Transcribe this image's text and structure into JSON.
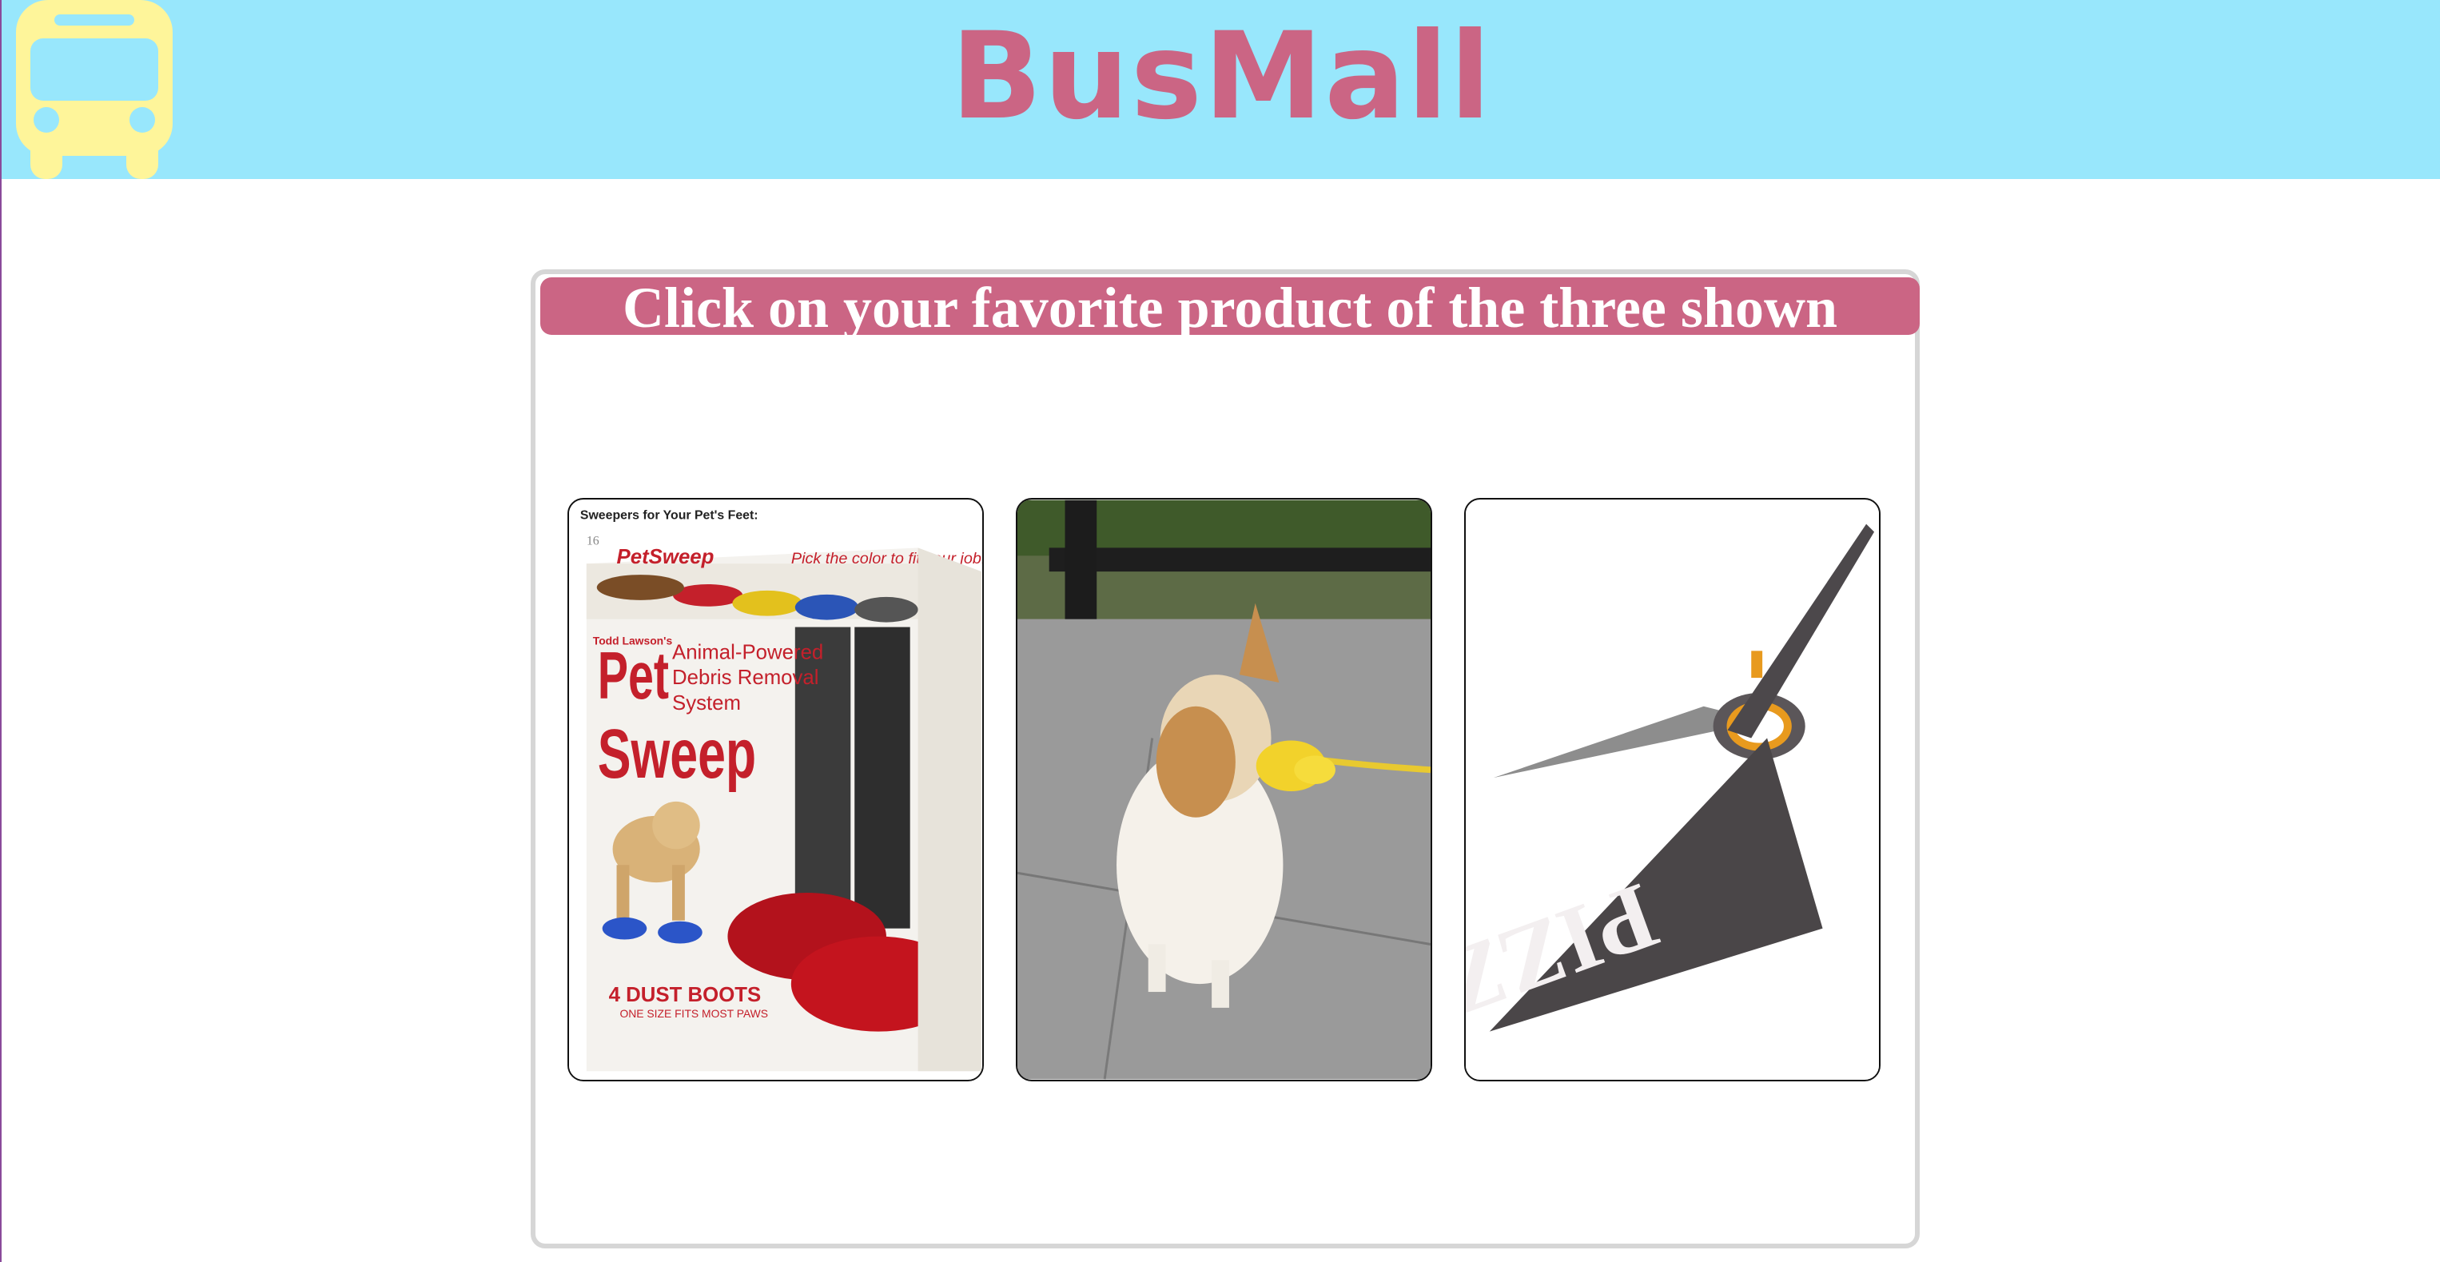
{
  "header": {
    "title": "BusMall",
    "logo_icon": "bus-icon",
    "background_color": "#98e7fc",
    "title_color": "#cb6584",
    "logo_color": "#fef59a"
  },
  "main": {
    "instruction": "Click on your favorite product of the three shown",
    "instruction_bg": "#cb6584",
    "products": [
      {
        "name": "pet-sweep",
        "image_alt": "Pet Sweep dust boots for pets",
        "caption": "Sweepers for Your Pet's Feet:",
        "page_number": "16",
        "brand_line": "Todd Lawson's",
        "brand": "Pet Sweep",
        "tagline": "Animal-Powered Debris Removal System",
        "color_line": "Pick the color to fit your job.",
        "footer_line1": "4 DUST BOOTS",
        "footer_line2": "ONE SIZE FITS MOST PAWS"
      },
      {
        "name": "dog-duck",
        "image_alt": "Dog wearing a duck-bill muzzle"
      },
      {
        "name": "pizza-scissors",
        "image_alt": "Pizza scissors",
        "blade_text": "PIZZA"
      }
    ]
  }
}
